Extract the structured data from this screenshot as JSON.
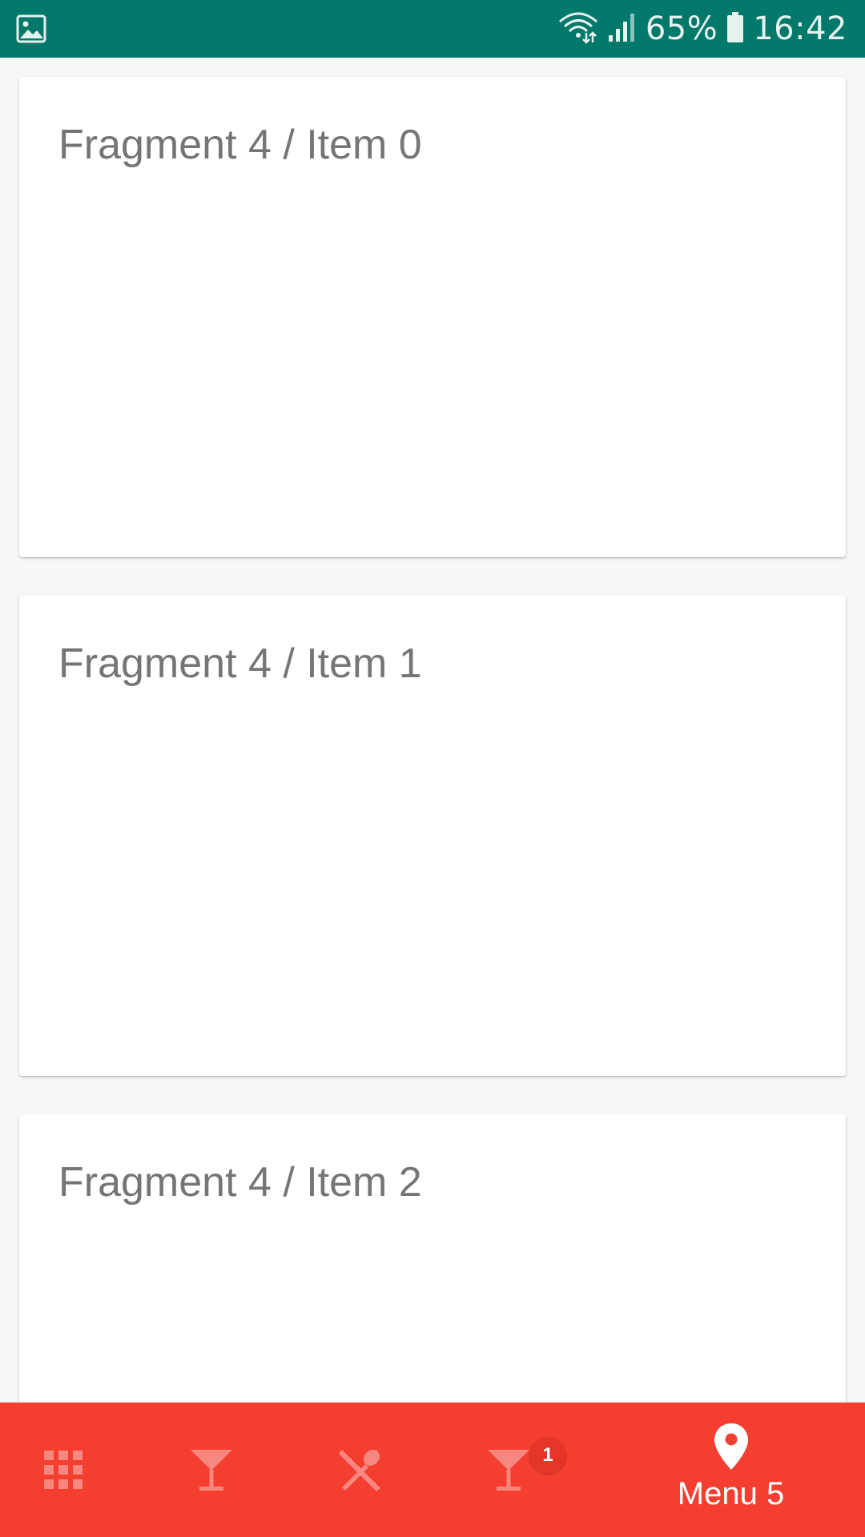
{
  "status_bar": {
    "battery": "65%",
    "time": "16:42",
    "icons": [
      "image-icon",
      "wifi-icon",
      "signal-icon",
      "battery-icon"
    ]
  },
  "cards": [
    {
      "title": "Fragment 4 / Item 0"
    },
    {
      "title": "Fragment 4 / Item 1"
    },
    {
      "title": "Fragment 4 / Item 2"
    }
  ],
  "bottom_nav": {
    "items": [
      {
        "icon": "apps-grid-icon",
        "active": false
      },
      {
        "icon": "cocktail-icon",
        "active": false
      },
      {
        "icon": "restaurant-icon",
        "active": false
      },
      {
        "icon": "cocktail-icon",
        "active": false,
        "badge": "1"
      },
      {
        "icon": "location-pin-icon",
        "active": true,
        "label": "Menu 5"
      }
    ]
  },
  "colors": {
    "status_bar": "#00796b",
    "nav_background": "#f43e30",
    "badge": "#e53528",
    "card_text": "#757575",
    "page_background": "#f7f7f7"
  }
}
